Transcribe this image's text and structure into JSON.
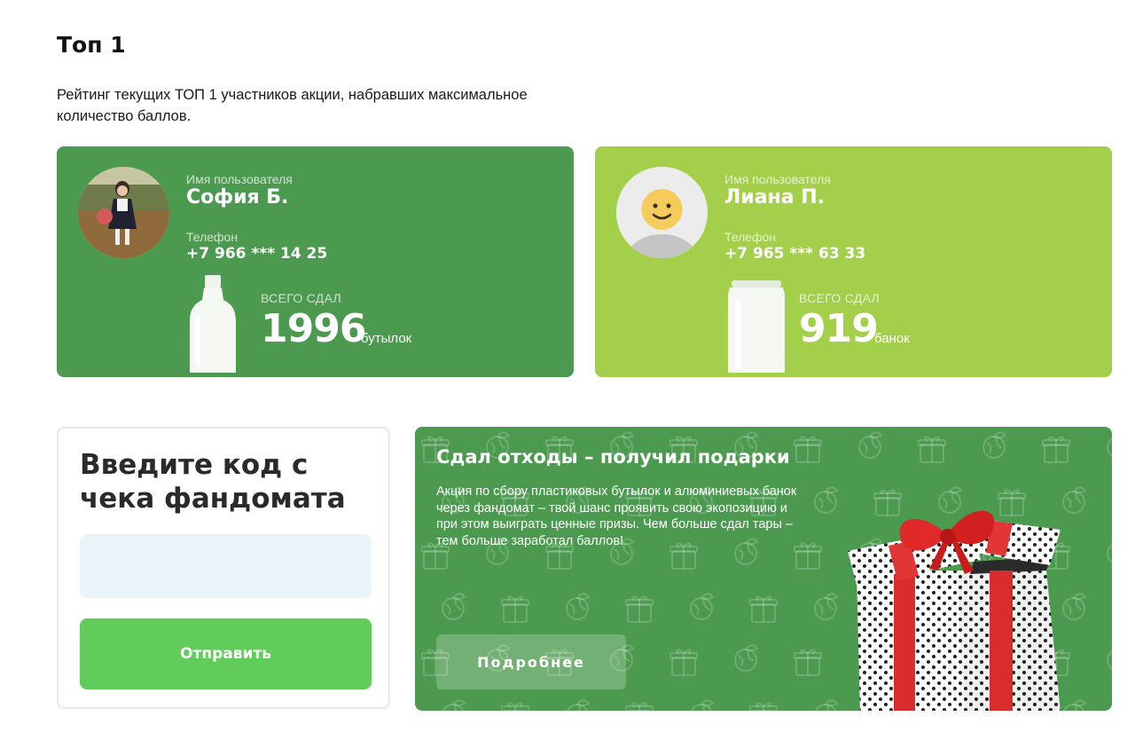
{
  "page": {
    "title": "Топ 1",
    "subtitle": "Рейтинг текущих ТОП 1 участников акции, набравших максимальное количество баллов."
  },
  "leaders": [
    {
      "user_label": "Имя пользователя",
      "name": "София Б.",
      "phone_label": "Телефон",
      "phone": "+7 966 *** 14 25",
      "total_label": "ВСЕГО СДАЛ",
      "total": "1996",
      "unit": "бутылок",
      "card_color": "#4c9a50",
      "avatar": "photo",
      "container_icon": "bottle-icon"
    },
    {
      "user_label": "Имя пользователя",
      "name": "Лиана П.",
      "phone_label": "Телефон",
      "phone": "+7 965 *** 63 33",
      "total_label": "ВСЕГО СДАЛ",
      "total": "919",
      "unit": "банок",
      "card_color": "#a4cf4b",
      "avatar": "smiley-placeholder",
      "container_icon": "can-icon"
    }
  ],
  "code_form": {
    "title": "Введите код с чека фандомата",
    "input_value": "",
    "input_placeholder": "",
    "submit_label": "Отправить",
    "submit_color": "#62cc5a",
    "input_bg": "#e9f4f9"
  },
  "promo": {
    "title": "Сдал отходы – получил подарки",
    "text": "Акция по сбору пластиковых бутылок и алюминиевых банок через фандомат – твой шанс проявить свою экопозицию и при этом выиграть ценные призы. Чем больше сдал тары – тем больше заработал баллов!",
    "button_label": "Подробнее",
    "background_color": "#4c9a50",
    "pattern_icons": [
      "gift-icon",
      "earth-leaf-icon"
    ],
    "image": "gift-box-icon"
  }
}
